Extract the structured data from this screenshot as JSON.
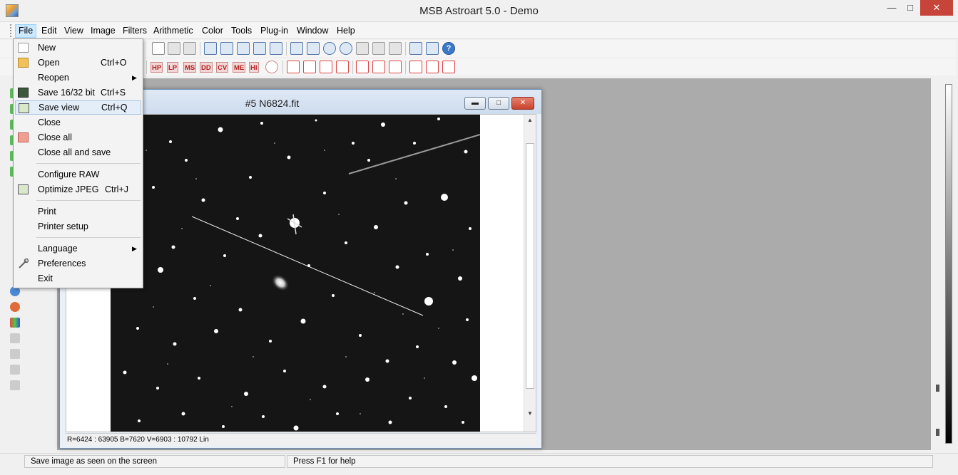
{
  "window": {
    "title": "MSB Astroart 5.0 - Demo"
  },
  "menubar": [
    "File",
    "Edit",
    "View",
    "Image",
    "Filters",
    "Arithmetic",
    "Color",
    "Tools",
    "Plug-in",
    "Window",
    "Help"
  ],
  "file_menu": {
    "items": [
      {
        "label": "New",
        "shortcut": ""
      },
      {
        "label": "Open",
        "shortcut": "Ctrl+O"
      },
      {
        "label": "Reopen",
        "shortcut": ""
      },
      {
        "label": "Save 16/32 bit",
        "shortcut": "Ctrl+S"
      },
      {
        "label": "Save view",
        "shortcut": "Ctrl+Q"
      },
      {
        "label": "Close",
        "shortcut": ""
      },
      {
        "label": "Close all",
        "shortcut": ""
      },
      {
        "label": "Close all and save",
        "shortcut": ""
      },
      {
        "label": "Configure RAW",
        "shortcut": ""
      },
      {
        "label": "Optimize JPEG",
        "shortcut": "Ctrl+J"
      },
      {
        "label": "Print",
        "shortcut": ""
      },
      {
        "label": "Printer setup",
        "shortcut": ""
      },
      {
        "label": "Language",
        "shortcut": ""
      },
      {
        "label": "Preferences",
        "shortcut": ""
      },
      {
        "label": "Exit",
        "shortcut": ""
      }
    ]
  },
  "toolbar2": {
    "filters": [
      "HP",
      "LP",
      "MS",
      "DD",
      "CV",
      "ME",
      "HI"
    ]
  },
  "image_window": {
    "title": "#5 N6824.fit",
    "status": "R=6424 : 63905    B=7620    V=6903 : 10792 Lin"
  },
  "statusbar": {
    "hint": "Save image as seen on the screen",
    "help": "Press F1 for help"
  }
}
